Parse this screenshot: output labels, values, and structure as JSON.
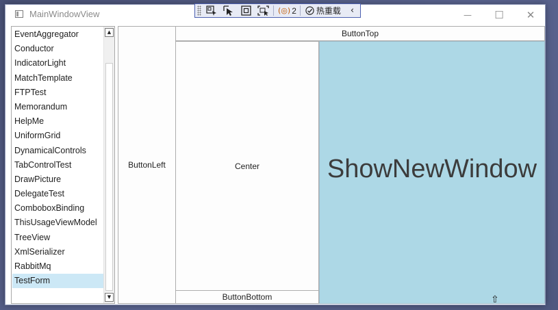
{
  "window": {
    "title": "MainWindowView",
    "minimize_glyph": "—",
    "maximize_glyph": "☐",
    "close_glyph": "✕"
  },
  "debug_toolbar": {
    "icons": [
      "select-element-icon",
      "track-focus-icon",
      "display-layout-adorners-icon",
      "track-focused-element-icon"
    ],
    "binding_count": "2",
    "hot_reload_label": "热重载",
    "collapse_glyph": "‹"
  },
  "list": {
    "items": [
      "EventAggregator",
      "Conductor",
      "IndicatorLight",
      "MatchTemplate",
      "FTPTest",
      "Memorandum",
      "HelpMe",
      "UniformGrid",
      "DynamicalControls",
      "TabControlTest",
      "DrawPicture",
      "DelegateTest",
      "ComboboxBinding",
      "ThisUsageViewModel",
      "TreeView",
      "XmlSerializer",
      "RabbitMq",
      "TestForm"
    ],
    "selected": "TestForm"
  },
  "dock": {
    "top": "ButtonTop",
    "left": "ButtonLeft",
    "center": "Center",
    "bottom": "ButtonBottom",
    "fill": "ShowNewWindow"
  },
  "colors": {
    "fill_button_bg": "#add8e6",
    "selected_item_bg": "#cce8f6",
    "toolbar_border": "#4b5fb0"
  }
}
